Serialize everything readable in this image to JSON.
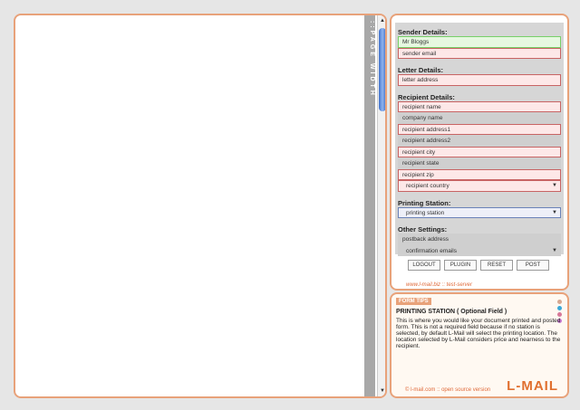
{
  "left_panel": {
    "page_width_label": "::PAGE WIDTH"
  },
  "form": {
    "sender": {
      "label": "Sender Details:",
      "name": "Mr Bloggs",
      "email": "sender email"
    },
    "letter": {
      "label": "Letter Details:",
      "address": "letter address"
    },
    "recipient": {
      "label": "Recipient Details:",
      "name": "recipient name",
      "company": "company name",
      "address1": "recipient address1",
      "address2": "recipient address2",
      "city": "recipient city",
      "state": "recipient state",
      "zip": "recipient zip",
      "country": "recipient country"
    },
    "printing": {
      "label": "Printing Station:",
      "station": "printing station"
    },
    "other": {
      "label": "Other Settings:",
      "postback": "postback address",
      "confirmation": "confirmation emails"
    }
  },
  "buttons": {
    "logout": "LOGOUT",
    "plugin": "PLUGIN",
    "reset": "RESET",
    "post": "POST"
  },
  "footer": "www.l-mail.biz :: test-server",
  "tips": {
    "tag": "FORM TIPS",
    "title": "PRINTING STATION ( Optional Field )",
    "text": "This is where you would like your document printed and posted form. This is not a required field because if no station is selected, by default L-Mail will select the printing location. The location selected by L-Mail considers price and nearness to the recipient.",
    "copyright": "© l-mail.com :: open source version",
    "logo": "L-MAIL",
    "dot_colors": [
      "#d8a890",
      "#3aa8d8",
      "#d87898",
      "#c878d0"
    ]
  }
}
